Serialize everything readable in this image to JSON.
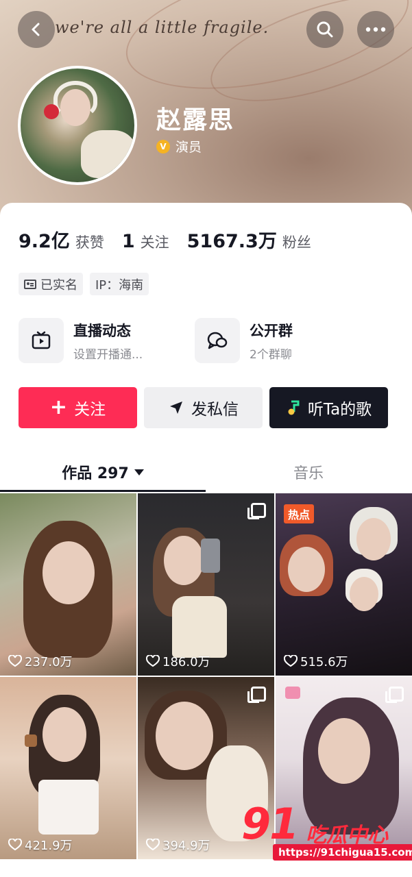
{
  "header": {
    "banner_text": "we're all a little fragile.",
    "name": "赵露思",
    "role": "演员",
    "verified_badge": "V"
  },
  "stats": {
    "likes_value": "9.2亿",
    "likes_label": "获赞",
    "following_value": "1",
    "following_label": "关注",
    "followers_value": "5167.3万",
    "followers_label": "粉丝"
  },
  "tags": {
    "verified_text": "已实名",
    "ip_text": "IP：海南"
  },
  "features": {
    "live_title": "直播动态",
    "live_sub": "设置开播通...",
    "group_title": "公开群",
    "group_sub": "2个群聊"
  },
  "actions": {
    "follow_label": "关注",
    "message_label": "发私信",
    "music_label": "听Ta的歌"
  },
  "tabs": {
    "works_label": "作品 297",
    "music_label": "音乐"
  },
  "grid": [
    {
      "likes": "237.0万"
    },
    {
      "likes": "186.0万"
    },
    {
      "likes": "515.6万",
      "badge": "热点"
    },
    {
      "likes": "421.9万"
    },
    {
      "likes": "394.9万"
    },
    {
      "likes": ""
    }
  ],
  "watermark": {
    "num": "91",
    "cn": "吃瓜中心",
    "url": "https://91chigua15.com"
  },
  "colors": {
    "accent": "#fe2c55",
    "dark_button": "#161823",
    "hot_badge": "#f05a2a"
  }
}
